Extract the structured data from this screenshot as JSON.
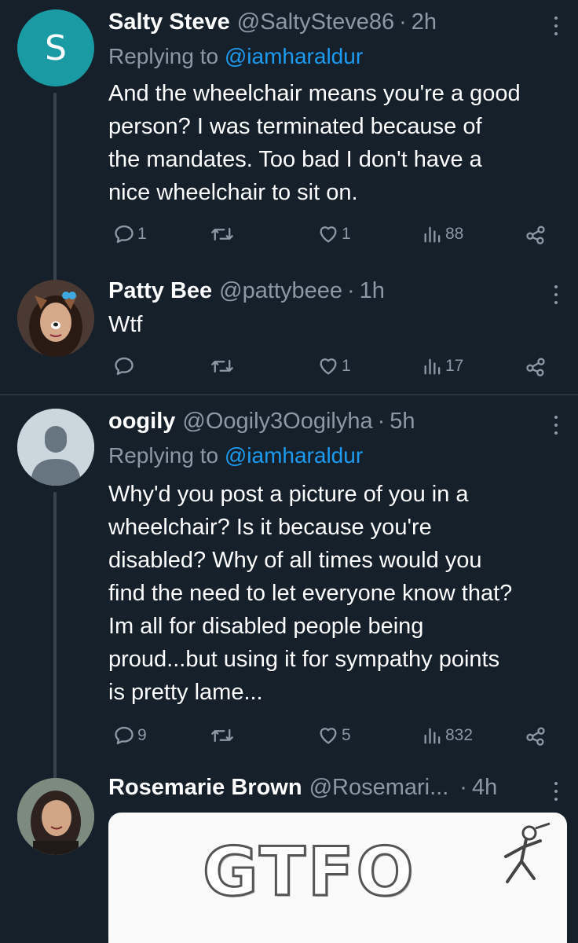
{
  "tweets": [
    {
      "name": "Salty Steve",
      "handle": "@SaltySteve86",
      "time": "2h",
      "avatar_letter": "S",
      "avatar_color": "#1a9ba3",
      "replying_prefix": "Replying to",
      "replying_to": "@iamharaldur",
      "text": "And the wheelchair means you're a good\nperson?  I was terminated because of\nthe mandates.  Too bad I don't have a\nnice wheelchair to sit on.",
      "replies": "1",
      "retweets": "",
      "likes": "1",
      "views": "88"
    },
    {
      "name": "Patty Bee",
      "handle": "@pattybeee",
      "time": "1h",
      "text": "Wtf",
      "replies": "",
      "retweets": "",
      "likes": "1",
      "views": "17"
    },
    {
      "name": "oogily",
      "handle": "@Oogily3Oogilyha",
      "time": "5h",
      "replying_prefix": "Replying to",
      "replying_to": "@iamharaldur",
      "text": "Why'd you post a picture of you in a\nwheelchair? Is it because you're\ndisabled? Why of all times would you\nfind the need to let everyone know that?\nIm all for disabled people being\nproud...but using it for sympathy points\nis pretty lame...",
      "replies": "9",
      "retweets": "",
      "likes": "5",
      "views": "832"
    },
    {
      "name": "Rosemarie Brown",
      "handle": "@Rosemari...",
      "time": "4h",
      "media_text": "GTFO"
    }
  ],
  "colors": {
    "background": "#15202b",
    "text_secondary": "#8b98a5",
    "link": "#1d9bf0",
    "divider": "#38444d"
  },
  "icons": [
    "more-icon",
    "reply-icon",
    "retweet-icon",
    "like-icon",
    "views-icon",
    "share-icon"
  ]
}
